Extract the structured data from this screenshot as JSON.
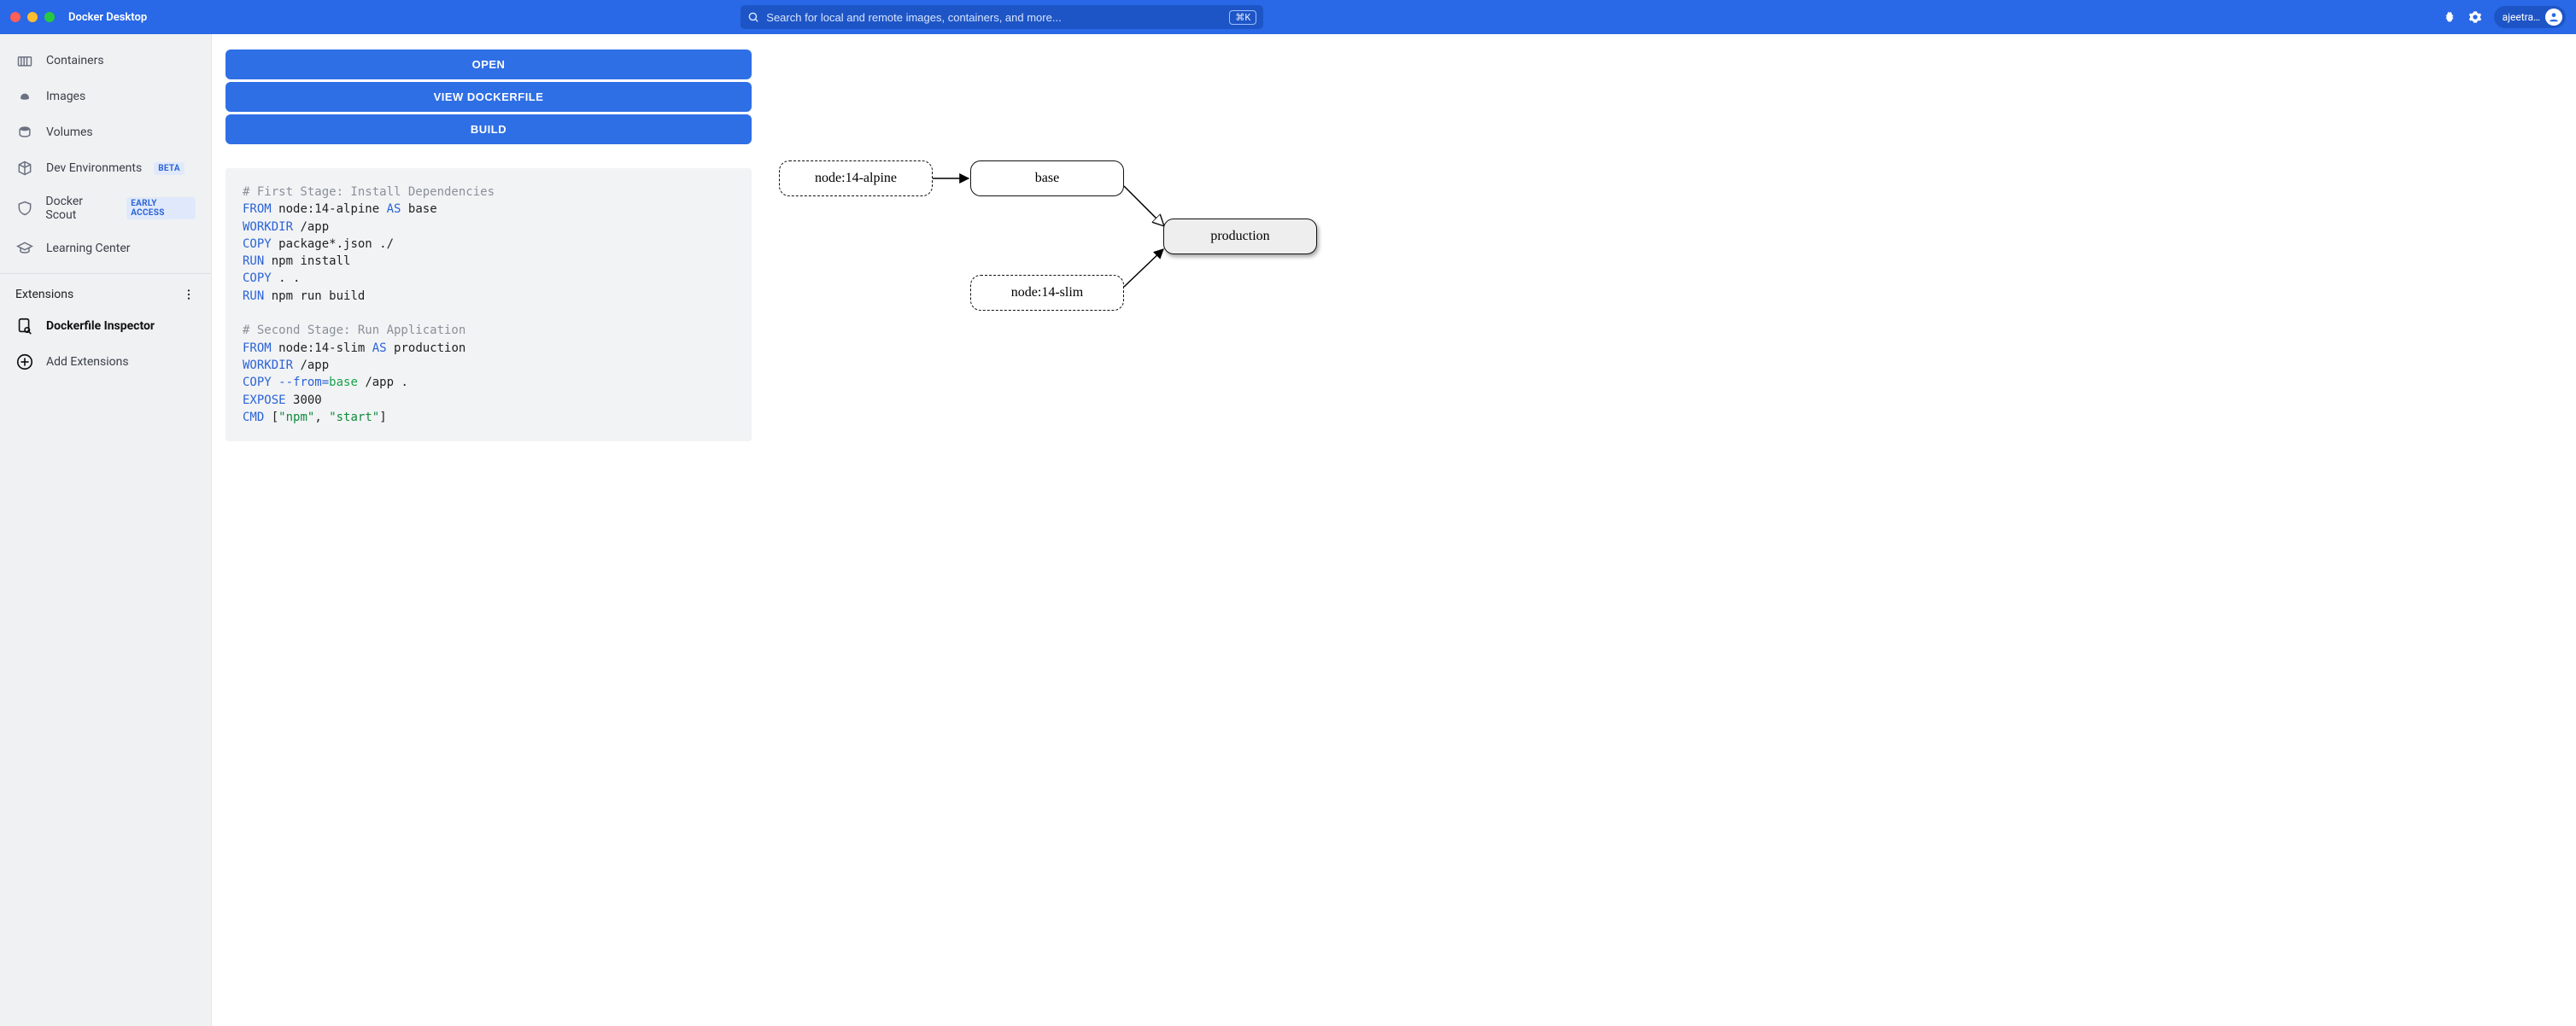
{
  "app": {
    "title": "Docker Desktop"
  },
  "search": {
    "placeholder": "Search for local and remote images, containers, and more...",
    "shortcut": "⌘K"
  },
  "user": {
    "name": "ajeetra…"
  },
  "sidebar": {
    "items": [
      {
        "label": "Containers"
      },
      {
        "label": "Images"
      },
      {
        "label": "Volumes"
      },
      {
        "label": "Dev Environments",
        "badge": "BETA"
      },
      {
        "label": "Docker Scout",
        "badge": "EARLY ACCESS"
      },
      {
        "label": "Learning Center"
      }
    ],
    "extensions_header": "Extensions",
    "ext_items": [
      {
        "label": "Dockerfile Inspector",
        "active": true
      },
      {
        "label": "Add Extensions"
      }
    ]
  },
  "actions": {
    "open": "OPEN",
    "view": "VIEW DOCKERFILE",
    "build": "BUILD"
  },
  "dockerfile": {
    "c1": "# First Stage: Install Dependencies",
    "from1_kw": "FROM",
    "from1_img": "node:14-alpine",
    "as1": "AS",
    "from1_stage": "base",
    "workdir_kw": "WORKDIR",
    "workdir1": "/app",
    "copy_kw": "COPY",
    "copy1": "package*.json ./",
    "run_kw": "RUN",
    "run1": "npm install",
    "copy2": ". .",
    "run2": "npm run build",
    "c2": "# Second Stage: Run Application",
    "from2_img": "node:14-slim",
    "as2": "AS",
    "from2_stage": "production",
    "workdir2": "/app",
    "copyfrom_flag": "--from=",
    "copyfrom_stage": "base",
    "copyfrom_rest": " /app .",
    "expose_kw": "EXPOSE",
    "expose_v": "3000",
    "cmd_kw": "CMD",
    "cmd_open": "[",
    "cmd_s1": "\"npm\"",
    "cmd_comma": ", ",
    "cmd_s2": "\"start\"",
    "cmd_close": "]"
  },
  "graph": {
    "n1": "node:14-alpine",
    "n2": "base",
    "n3": "node:14-slim",
    "n4": "production"
  },
  "chart_data": {
    "type": "diagram",
    "nodes": [
      {
        "id": "node:14-alpine",
        "kind": "external-image"
      },
      {
        "id": "base",
        "kind": "stage"
      },
      {
        "id": "node:14-slim",
        "kind": "external-image"
      },
      {
        "id": "production",
        "kind": "stage",
        "final": true
      }
    ],
    "edges": [
      {
        "from": "node:14-alpine",
        "to": "base"
      },
      {
        "from": "base",
        "to": "production"
      },
      {
        "from": "node:14-slim",
        "to": "production"
      }
    ]
  }
}
